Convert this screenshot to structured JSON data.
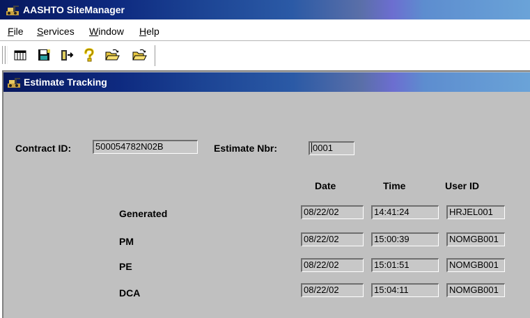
{
  "app": {
    "title": "AASHTO SiteManager"
  },
  "menu": [
    {
      "accel": "F",
      "rest": "ile"
    },
    {
      "accel": "S",
      "rest": "ervices"
    },
    {
      "accel": "W",
      "rest": "indow"
    },
    {
      "accel": "H",
      "rest": "elp"
    }
  ],
  "toolbar": {
    "icons": [
      "grid-table-icon",
      "save-floppy-icon",
      "exit-door-icon",
      "help-question-icon",
      "open-folder-icon",
      "open-folder-alt-icon"
    ]
  },
  "window": {
    "title": "Estimate Tracking"
  },
  "form": {
    "contract_id_label": "Contract ID:",
    "contract_id_value": "500054782N02B",
    "estimate_nbr_label": "Estimate Nbr:",
    "estimate_nbr_value": "0001"
  },
  "tracking": {
    "headers": {
      "date": "Date",
      "time": "Time",
      "user_id": "User ID"
    },
    "rows": [
      {
        "label": "Generated",
        "date": "08/22/02",
        "time": "14:41:24",
        "user_id": "HRJEL001"
      },
      {
        "label": "PM",
        "date": "08/22/02",
        "time": "15:00:39",
        "user_id": "NOMGB001"
      },
      {
        "label": "PE",
        "date": "08/22/02",
        "time": "15:01:51",
        "user_id": "NOMGB001"
      },
      {
        "label": "DCA",
        "date": "08/22/02",
        "time": "15:04:11",
        "user_id": "NOMGB001"
      }
    ]
  },
  "colors": {
    "title_bar_start": "#07185e",
    "title_bar_end": "#6aa3d8",
    "client_background": "#c0c0c0",
    "field_background": "#c8c8c8"
  }
}
